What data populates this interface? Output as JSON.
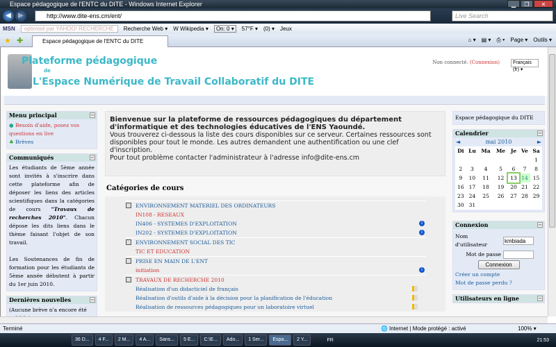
{
  "window": {
    "title": "Espace pédagogique de l'ENTC du DITE - Windows Internet Explorer",
    "minimize": "▁",
    "maximize": "❐",
    "close": "✕"
  },
  "browser": {
    "url": "http://www.dite-ens.cm/ent/",
    "search_placeholder": "Live Search",
    "back": "◀",
    "forward": "▶",
    "toolbar": [
      "optimisé par YAHOO! RECHERCHE",
      "Recherche Web ▾",
      "W Wikipedia ▾",
      "On: 0 ▾",
      "57°F ▾",
      "(0) ▾",
      "Jeux"
    ],
    "toolbar_logo": "MSN",
    "tab_title": "Espace pédagogique de l'ENTC du DITE",
    "tab_tools": [
      "⌂ ▾",
      "▤ ▾",
      "⎙ ▾",
      "Page ▾",
      "Outils ▾"
    ]
  },
  "header": {
    "title_line1": "Plateforme pédagogique",
    "title_line2": "de",
    "title_line3": "L'Espace Numérique de Travail Collaboratif du DITE",
    "login_status": "Non connecté.",
    "login_link": "(Connexion)",
    "language": "Français (fr) ▾"
  },
  "left": {
    "menu": {
      "title": "Menu principal",
      "items": [
        "Besoin d'aide, posez vos questions en live",
        "Brèves"
      ]
    },
    "communiques": {
      "title": "Communiqués",
      "p1_a": "Les étudiants de 5ème année sont invités à s'inscrire dans cette plateforme afin de déposer les liens des articles scientifiques dans la catégories de cours ",
      "p1_em": "\"Travaux de recherches 2010\"",
      "p1_b": ". Chacun dépose les dits liens dans le thème faisant l'objet de son travail.",
      "p2": "Les Soutenances de fin de formation pour les étudiants de 5ème année débutent à partir du 1er juin 2010."
    },
    "news": {
      "title": "Dernières nouvelles",
      "text": "(Aucune brève n'a encore été publiée)"
    }
  },
  "center": {
    "welcome_title": "Bienvenue sur la plateforme de ressources pédagogiques du département d'informatique et des technologies éducatives de l'ENS Yaoundé.",
    "welcome_body": "Vous trouverez ci-dessous la liste des cours disponibles sur ce serveur. Certaines ressources sont disponibles pour tout le monde. Les autres demandent une authentification ou une clef d'inscription.",
    "contact": "Pour tout problème contacter l'administrateur à l'adresse info@dite-ens.cm",
    "categories_title": "Catégories de cours",
    "categories": [
      {
        "name": "ENVIRONNEMENT MATERIEL DES ORDINATEURS",
        "courses": [
          {
            "name": "IN108 - RESEAUX",
            "icon": ""
          },
          {
            "name": "IN406 - SYSTEMES D'EXPLOITATION",
            "icon": "info"
          },
          {
            "name": "IN202 - SYSTEMES D'EXPLOITATION",
            "icon": "info"
          }
        ]
      },
      {
        "name": "ENVIRONNEMENT SOCIAL DES TIC",
        "courses": [
          {
            "name": "TIC ET EDUCATION",
            "icon": ""
          }
        ]
      },
      {
        "name": "PRISE EN MAIN DE L'ENT",
        "courses": [
          {
            "name": "initiation",
            "icon": "info"
          }
        ]
      },
      {
        "name": "TRAVAUX DE RECHERCHE 2010",
        "courses": [
          {
            "name": "Réalisation d'un didacticiel de français",
            "icon": "key"
          },
          {
            "name": "Réalisation d'outils d'aide à la décision pour la planification de l'éducation",
            "icon": "key"
          },
          {
            "name": "Réalisation de ressources pédagogiques pour un laboratoire virtuel",
            "icon": "key"
          }
        ]
      }
    ]
  },
  "right": {
    "site_name": "Espace pédagogique du DITE",
    "calendar": {
      "title": "Calendrier",
      "month": "mai 2010",
      "prev": "◄",
      "next": "►",
      "days": [
        "Di",
        "Lu",
        "Ma",
        "Me",
        "Je",
        "Ve",
        "Sa"
      ],
      "weeks": [
        [
          "",
          "",
          "",
          "",
          "",
          "",
          "1"
        ],
        [
          "2",
          "3",
          "4",
          "5",
          "6",
          "7",
          "8"
        ],
        [
          "9",
          "10",
          "11",
          "12",
          "13",
          "14",
          "15"
        ],
        [
          "16",
          "17",
          "18",
          "19",
          "20",
          "21",
          "22"
        ],
        [
          "23",
          "24",
          "25",
          "26",
          "27",
          "28",
          "29"
        ],
        [
          "30",
          "31",
          "",
          "",
          "",
          "",
          ""
        ]
      ],
      "today": "13",
      "event_day": "14"
    },
    "login": {
      "title": "Connexion",
      "username_label": "Nom d'utilisateur",
      "username_value": "kmbiada",
      "password_label": "Mot de passe",
      "button": "Connexion",
      "create_account": "Créer un compte",
      "lost_password": "Mot de passe perdu ?"
    },
    "online_title": "Utilisateurs en ligne"
  },
  "status": {
    "text": "Terminé",
    "zone": "Internet | Mode protégé : activé",
    "zoom": "100% ▾"
  },
  "taskbar": {
    "items": [
      "36 D...",
      "4 F...",
      "2 M...",
      "4 A...",
      "Sans...",
      "5 E...",
      "C:\\E...",
      "Ado...",
      "1 Ser...",
      "Espa...",
      "2 Y..."
    ],
    "active": "Espa...",
    "lang": "FR",
    "clock": "21:53"
  }
}
